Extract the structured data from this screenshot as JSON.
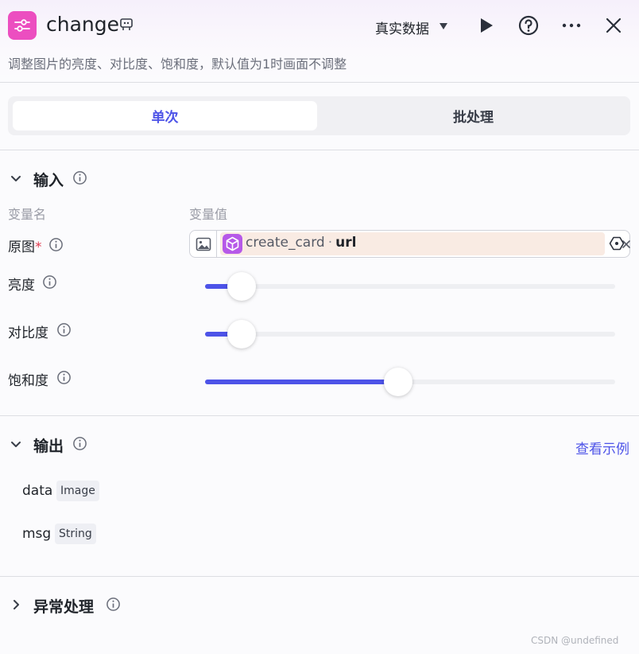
{
  "header": {
    "title": "change",
    "data_mode": "真实数据",
    "description": "调整图片的亮度、对比度、饱和度，默认值为1时画面不调整"
  },
  "tabs": [
    {
      "label": "单次",
      "active": true
    },
    {
      "label": "批处理",
      "active": false
    }
  ],
  "input_section": {
    "title": "输入",
    "col_name": "变量名",
    "col_value": "变量值",
    "params": [
      {
        "label": "原图",
        "required_mark": "*",
        "ref_node": "create_card",
        "ref_separator": "·",
        "ref_key": "url"
      },
      {
        "label": "亮度",
        "level_fraction": 0.09
      },
      {
        "label": "对比度",
        "level_fraction": 0.09
      },
      {
        "label": "饱和度",
        "level_fraction": 0.47
      }
    ]
  },
  "output_section": {
    "title": "输出",
    "view_example": "查看示例",
    "outputs": [
      {
        "name": "data",
        "type": "Image"
      },
      {
        "name": "msg",
        "type": "String"
      }
    ]
  },
  "error_section": {
    "title": "异常处理"
  },
  "watermark": "CSDN @undefined",
  "colors": {
    "accent": "#4d53e8",
    "app_icon": "#ec4ec0",
    "node_icon": "#b659e8",
    "ref_chip": "#f9ebe3",
    "required": "#e0394e"
  },
  "icons": [
    "sliders-icon",
    "edit-icon",
    "caret-down-icon",
    "play-icon",
    "help-icon",
    "more-icon",
    "close-icon",
    "chevron-down-icon",
    "chevron-right-icon",
    "info-icon",
    "image-icon",
    "cube-icon",
    "variable-icon"
  ]
}
